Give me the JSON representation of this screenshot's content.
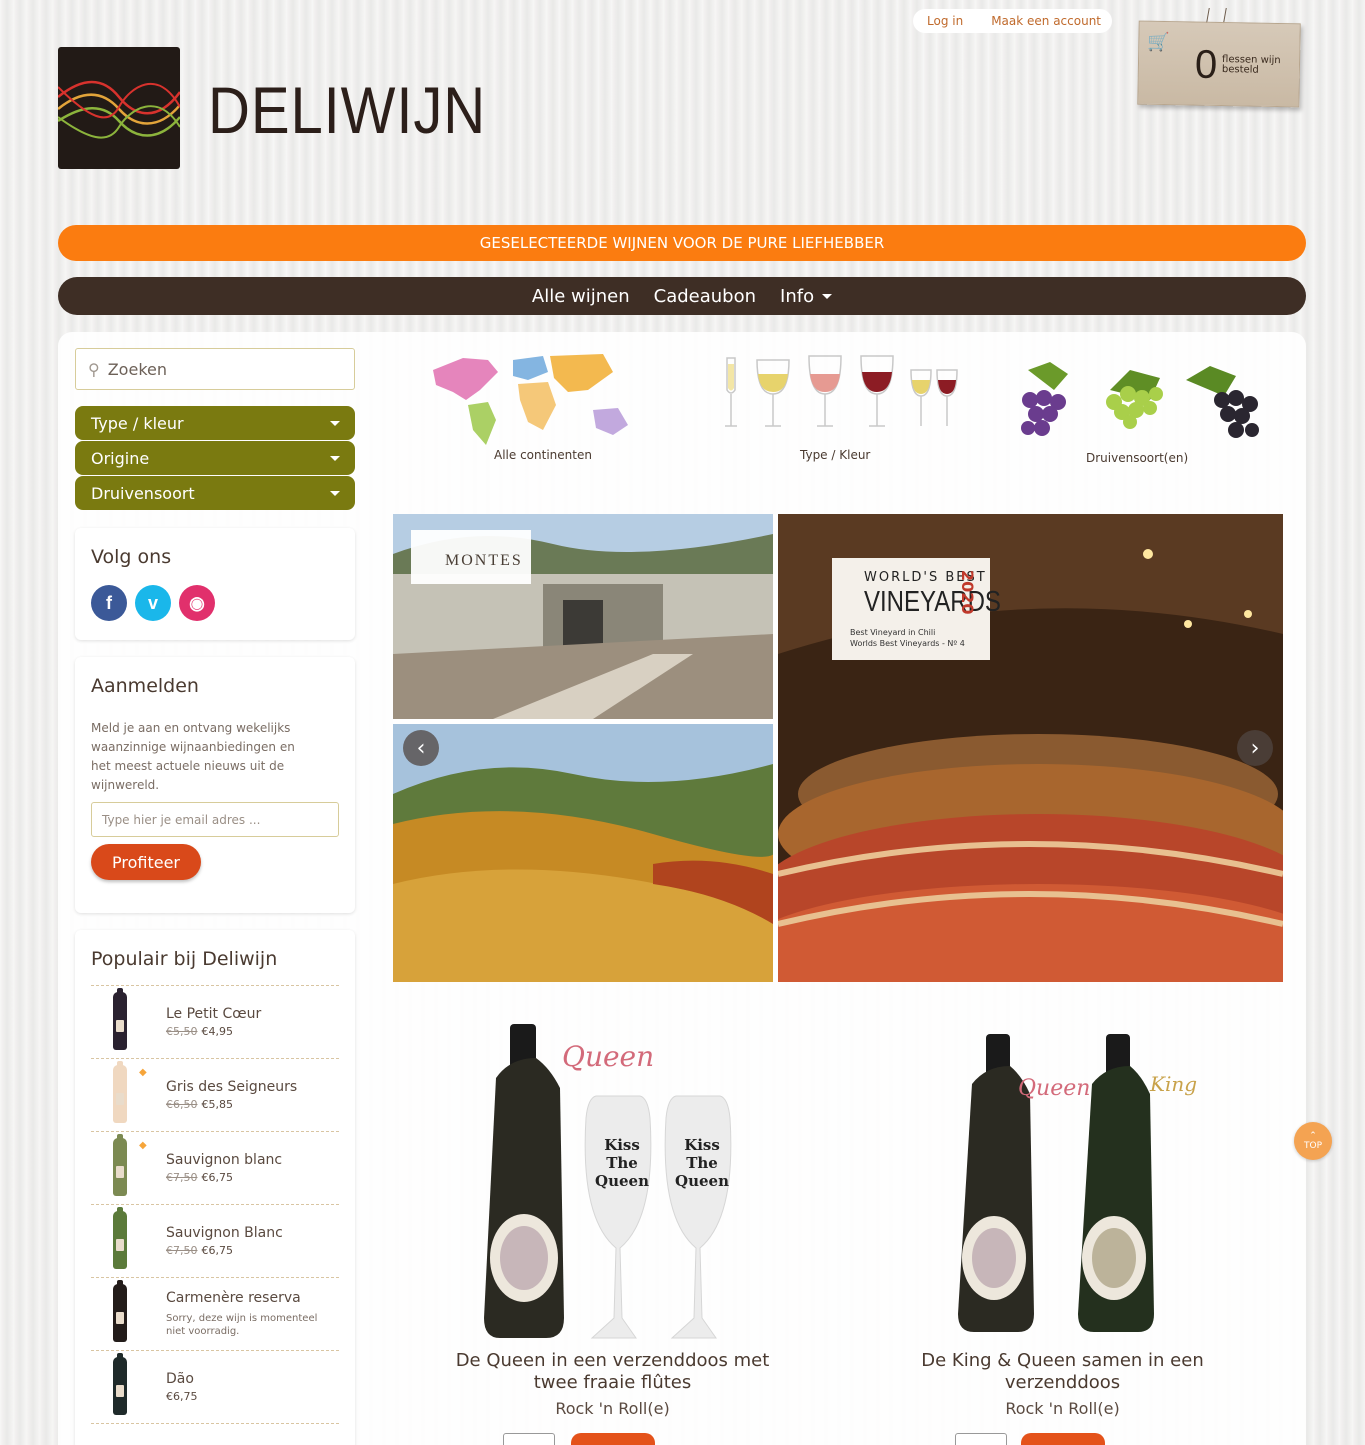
{
  "header": {
    "login": "Log in",
    "register": "Maak een account",
    "cart_count": "0",
    "cart_text": "flessen wijn besteld",
    "brand": "DELIWIJN"
  },
  "banner": "GESELECTEERDE WIJNEN VOOR DE PURE LIEFHEBBER",
  "nav": {
    "items": [
      "Alle wijnen",
      "Cadeaubon",
      "Info"
    ]
  },
  "sidebar": {
    "search_placeholder": "Zoeken",
    "filters": [
      "Type / kleur",
      "Origine",
      "Druivensoort"
    ],
    "follow_title": "Volg ons",
    "newsletter": {
      "title": "Aanmelden",
      "text": "Meld je aan en ontvang wekelijks waanzinnige wijnaanbiedingen en het meest actuele nieuws uit de wijnwereld.",
      "placeholder": "Type hier je email adres ...",
      "button": "Profiteer"
    },
    "popular": {
      "title": "Populair bij Deliwijn",
      "items": [
        {
          "name": "Le Petit Cœur",
          "old": "€5,50",
          "price": "€4,95",
          "color": "#2a2230"
        },
        {
          "name": "Gris des Seigneurs",
          "old": "€6,50",
          "price": "€5,85",
          "color": "#f0d8c0"
        },
        {
          "name": "Sauvignon blanc",
          "old": "€7,50",
          "price": "€6,75",
          "color": "#7c8a52"
        },
        {
          "name": "Sauvignon Blanc",
          "old": "€7,50",
          "price": "€6,75",
          "color": "#5b7a3a"
        },
        {
          "name": "Carmenère reserva",
          "note": "Sorry, deze wijn is momenteel niet voorradig.",
          "color": "#231c1a"
        },
        {
          "name": "Dão",
          "price": "€6,75",
          "color": "#1f2a2a"
        }
      ]
    }
  },
  "categories": [
    "Alle continenten",
    "Type / Kleur",
    "Druivensoort(en)"
  ],
  "slider": {
    "montes": "MONTES",
    "award_top": "WORLD'S BEST",
    "award_main": "VINEYARDS",
    "award_year": "2020",
    "award_line1": "Best Vineyard in Chili",
    "award_line2": "Worlds Best Vineyards - Nº 4"
  },
  "products": [
    {
      "title": "De Queen in een verzenddoos met twee fraaie flûtes",
      "subtitle": "Rock 'n Roll(e)",
      "script": "Queen"
    },
    {
      "title": "De King & Queen samen in een verzenddoos",
      "subtitle": "Rock 'n Roll(e)",
      "script_queen": "Queen",
      "script_king": "King"
    }
  ],
  "glass_text": "Kiss The Queen",
  "top_label": "TOP"
}
